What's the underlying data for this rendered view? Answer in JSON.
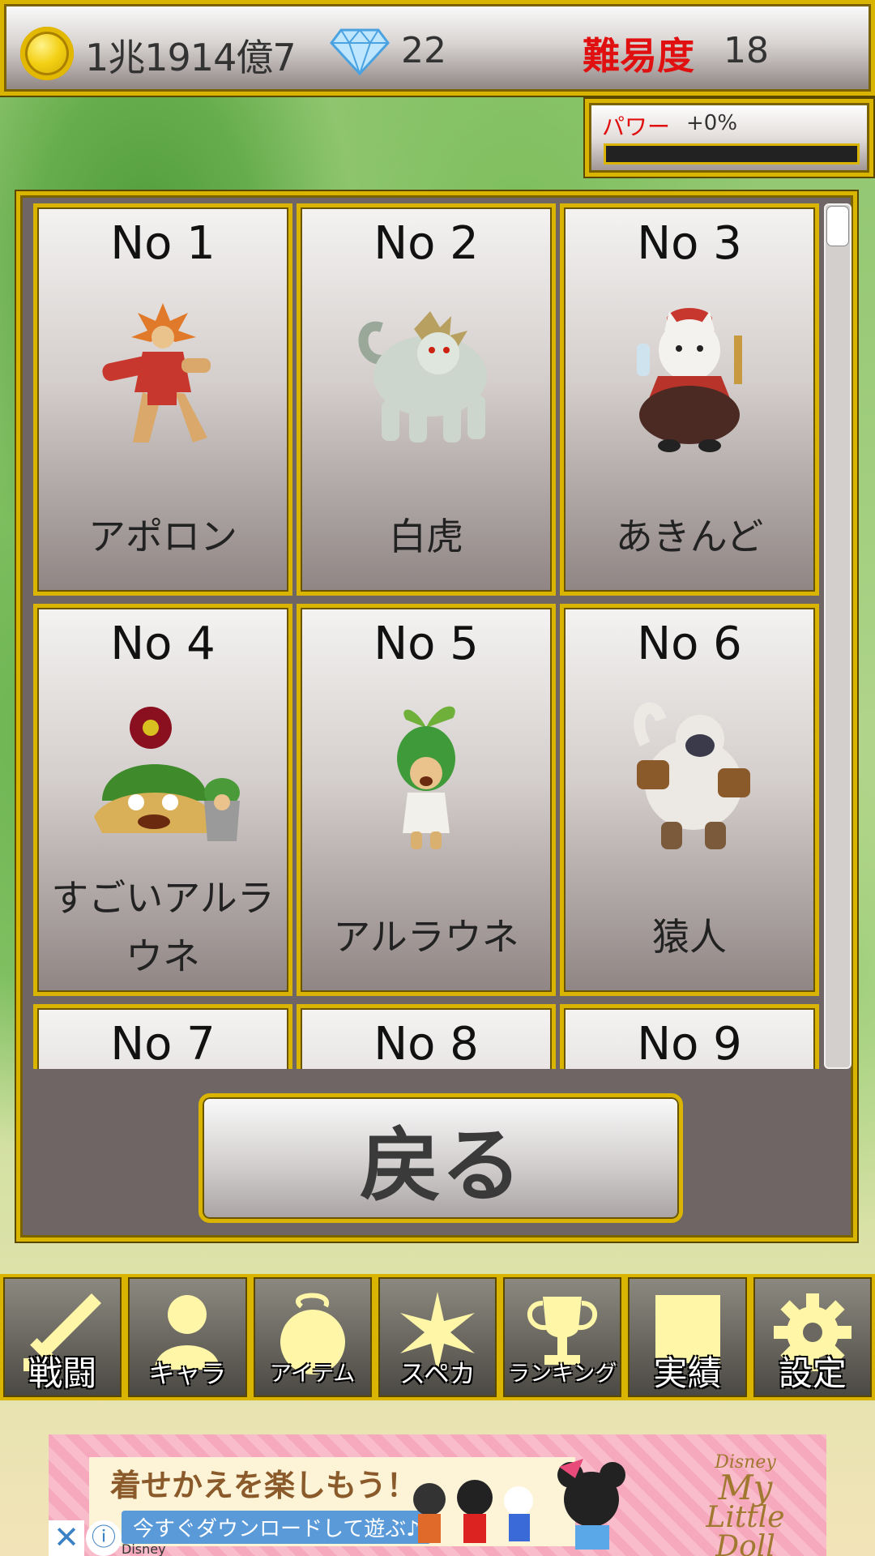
{
  "status": {
    "money": "1兆1914億7",
    "gems": "22",
    "difficulty_label": "難易度",
    "difficulty_value": "18"
  },
  "power": {
    "label": "パワー",
    "value": "+0%",
    "level": 0
  },
  "monsters": [
    {
      "no": "No 1",
      "name": "アポロン"
    },
    {
      "no": "No 2",
      "name": "白虎"
    },
    {
      "no": "No 3",
      "name": "あきんど"
    },
    {
      "no": "No 4",
      "name": "すごいアルラウネ"
    },
    {
      "no": "No 5",
      "name": "アルラウネ"
    },
    {
      "no": "No 6",
      "name": "猿人"
    },
    {
      "no": "No 7",
      "name": ""
    },
    {
      "no": "No 8",
      "name": ""
    },
    {
      "no": "No 9",
      "name": ""
    }
  ],
  "back_button": "戻る",
  "nav": [
    {
      "label": "戦闘",
      "icon": "sword-icon"
    },
    {
      "label": "キャラ",
      "icon": "person-icon"
    },
    {
      "label": "アイテム",
      "icon": "bag-icon"
    },
    {
      "label": "スペカ",
      "icon": "burst-icon"
    },
    {
      "label": "ランキング",
      "icon": "trophy-icon"
    },
    {
      "label": "実績",
      "icon": "square-icon"
    },
    {
      "label": "設定",
      "icon": "gear-icon"
    }
  ],
  "ad": {
    "headline": "着せかえを楽しもう！",
    "sub": "今すぐダウンロードして遊ぶ♪",
    "brand": "Disney",
    "logo_top": "Disney",
    "logo_main": "My",
    "logo_title": "Little Doll"
  },
  "colors": {
    "gold": "#d9b400",
    "difficulty_red": "#e11010",
    "panel": "#6f6564"
  }
}
